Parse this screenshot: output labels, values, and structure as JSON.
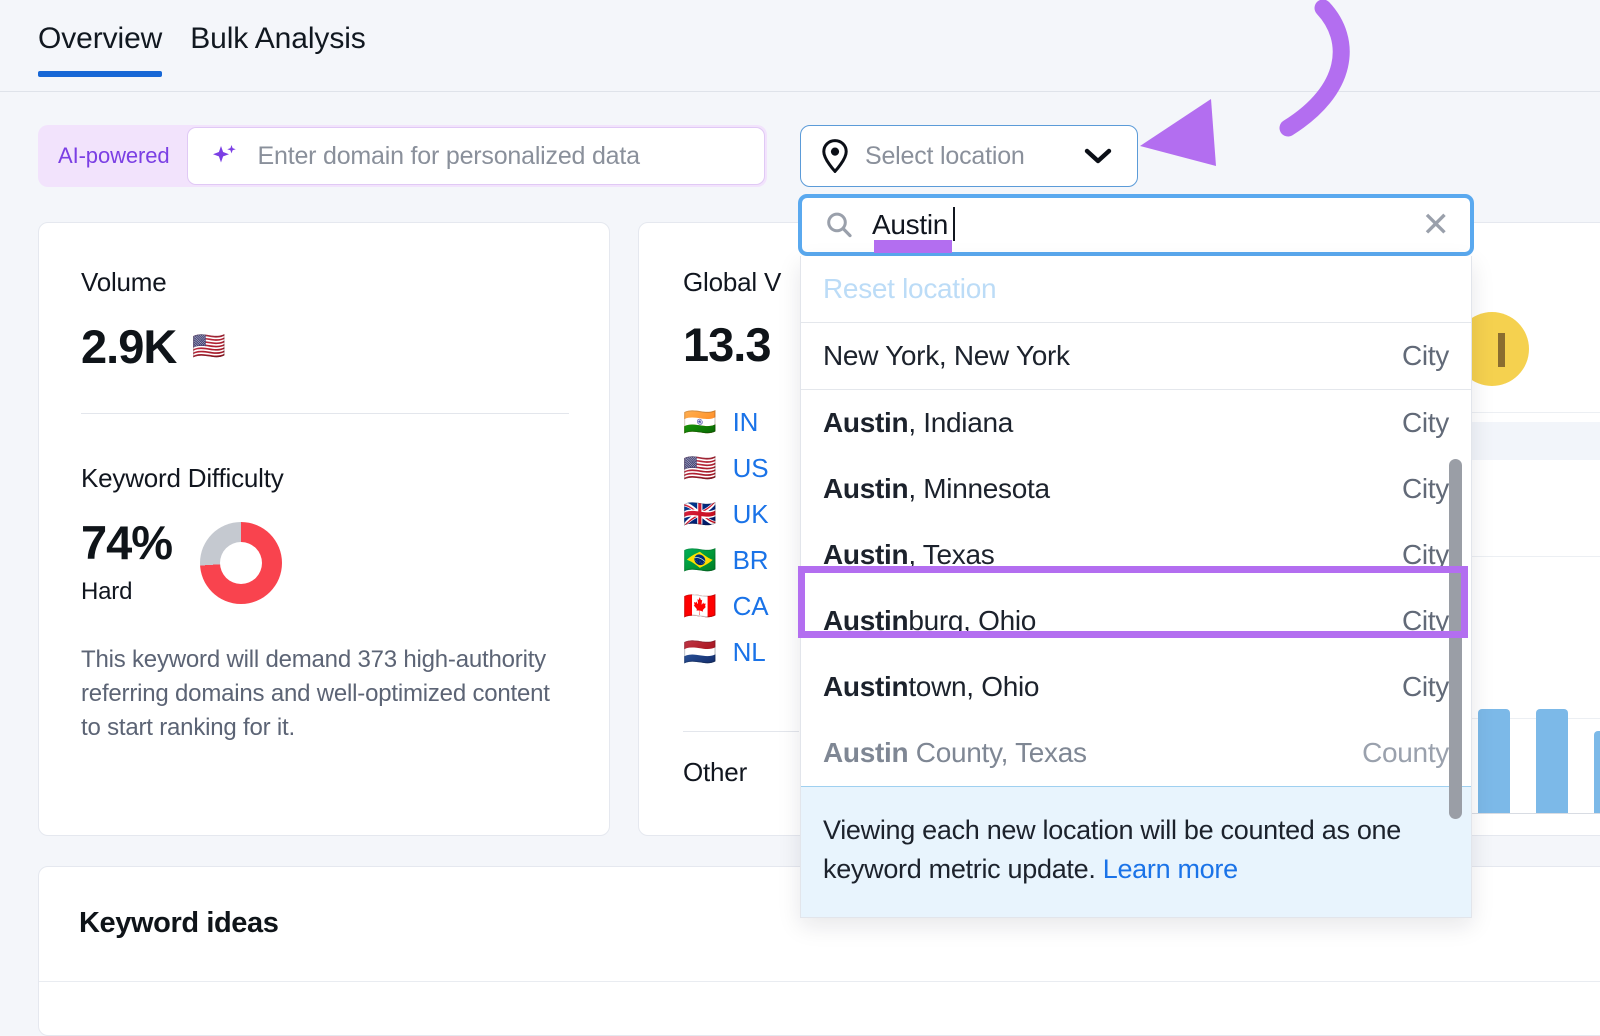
{
  "tabs": [
    {
      "label": "Overview",
      "active": true
    },
    {
      "label": "Bulk Analysis",
      "active": false
    }
  ],
  "search_bar": {
    "ai_badge": "AI-powered",
    "domain_placeholder": "Enter domain for personalized data",
    "sparkle_icon": "sparkle-icon"
  },
  "location_button": {
    "label": "Select location",
    "pin_icon": "location-pin-icon",
    "chevron_icon": "chevron-down-icon"
  },
  "location_dropdown": {
    "search_value": "Austin",
    "search_icon": "search-icon",
    "clear_icon": "close-icon",
    "reset_label": "Reset location",
    "items": [
      {
        "match": "",
        "rest": "New York, New York",
        "type": "City",
        "faded": false,
        "highlighted": false
      },
      {
        "match": "Austin",
        "rest": ", Indiana",
        "type": "City",
        "faded": false,
        "highlighted": false
      },
      {
        "match": "Austin",
        "rest": ", Minnesota",
        "type": "City",
        "faded": false,
        "highlighted": false
      },
      {
        "match": "Austin",
        "rest": ", Texas",
        "type": "City",
        "faded": false,
        "highlighted": true
      },
      {
        "match": "Austin",
        "rest": "burg, Ohio",
        "type": "City",
        "faded": false,
        "highlighted": false
      },
      {
        "match": "Austin",
        "rest": "town, Ohio",
        "type": "City",
        "faded": false,
        "highlighted": false
      },
      {
        "match": "Austin",
        "rest": " County, Texas",
        "type": "County",
        "faded": true,
        "highlighted": false
      }
    ],
    "note_text": "Viewing each new location will be counted as one keyword metric update. ",
    "note_link": "Learn more"
  },
  "volume_card": {
    "label": "Volume",
    "value": "2.9K",
    "flag": "🇺🇸",
    "kd_label": "Keyword Difficulty",
    "kd_value": "74%",
    "kd_level": "Hard",
    "kd_percent": 74,
    "kd_description": "This keyword will demand 373 high-authority referring domains and well-optimized content to start ranking for it."
  },
  "global_card": {
    "label": "Global V",
    "value": "13.3",
    "countries": [
      {
        "flag": "🇮🇳",
        "code": "IN"
      },
      {
        "flag": "🇺🇸",
        "code": "US"
      },
      {
        "flag": "🇬🇧",
        "code": "UK"
      },
      {
        "flag": "🇧🇷",
        "code": "BR"
      },
      {
        "flag": "🇨🇦",
        "code": "CA"
      },
      {
        "flag": "🇳🇱",
        "code": "NL"
      }
    ],
    "other_label": "Other"
  },
  "keyword_ideas": {
    "title": "Keyword ideas"
  },
  "annotations": {
    "arrow": "curved-arrow-annotation",
    "box": "highlight-box-annotation",
    "underline": "underline-annotation",
    "color": "#b36ef0"
  },
  "colors": {
    "accent_blue": "#1767d6",
    "ai_purple": "#7b3fe4",
    "difficulty_red": "#f9434e",
    "annotation_purple": "#b36ef0",
    "link_blue": "#1a73e8"
  }
}
